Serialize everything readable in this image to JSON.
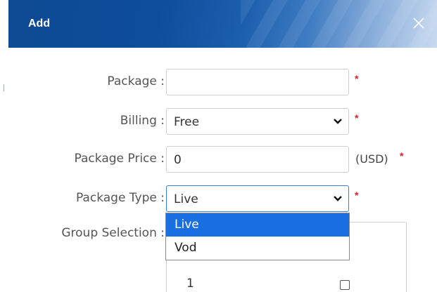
{
  "dialog": {
    "title": "Add",
    "close_icon": "close-icon"
  },
  "form": {
    "package": {
      "label": "Package :",
      "value": "",
      "required": "*"
    },
    "billing": {
      "label": "Billing :",
      "value": "Free",
      "required": "*"
    },
    "package_price": {
      "label": "Package Price :",
      "value": "0",
      "unit": "(USD)",
      "required": "*"
    },
    "package_type": {
      "label": "Package Type :",
      "value": "Live",
      "required": "*"
    },
    "group_selection": {
      "label": "Group Selection :",
      "rows": [
        {
          "name": "1"
        }
      ]
    }
  },
  "package_type_dropdown": {
    "options": [
      "Live",
      "Vod"
    ],
    "selected": "Live"
  },
  "colors": {
    "header_blue": "#0f4a93",
    "required_red": "#e0202a",
    "selected_option": "#1a6fe0",
    "focus_border": "#3a7bd5"
  }
}
